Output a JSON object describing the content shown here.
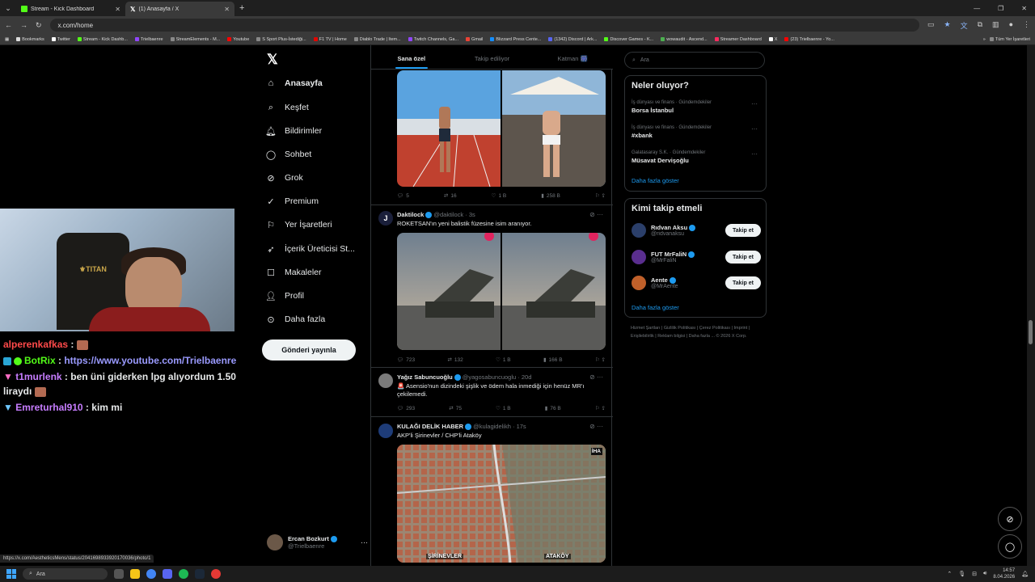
{
  "browser": {
    "tabs": [
      {
        "title": "Stream - Kick Dashboard",
        "icon": "kick-icon"
      },
      {
        "title": "(1) Anasayfa / X",
        "icon": "x-icon"
      }
    ],
    "url": "x.com/home",
    "bookmarks": [
      "Bookmarks",
      "Twitter",
      "Stream - Kick Dashb...",
      "Trielbaenre",
      "StreamElements - M...",
      "Youtube",
      "S Sport Plus-İstediği...",
      "F1 TV | Home",
      "Diablo Trade | Item...",
      "Twitch Channels, Ga...",
      "Gmail",
      "Blizzard Press Cente...",
      "(1342) Discord | Ark...",
      "Discover Games - K...",
      "wowaudit - Ascend...",
      "Streamer Dashboard",
      "X",
      "(23) Trielbaenre - Yo..."
    ],
    "bookmarks_right": "Tüm Yer İşaretleri",
    "status_url": "https://x.com/AestheticsMens/status/2041698933920170036/photo/1"
  },
  "chat": [
    {
      "user": "alperenkafkas",
      "sep": " : ",
      "msg": "",
      "color": "#ff4a4a",
      "emote": true
    },
    {
      "user": "BotRix",
      "sep": " : ",
      "msg": "https://www.youtube.com/Trielbaenre",
      "color": "#53fc18",
      "msg_color": "#9a9aff",
      "emote": false
    },
    {
      "user": "t1murlenk",
      "sep": " : ",
      "msg": "ben üni giderken lpg alıyordum 1.50 liraydı",
      "color": "#c77dff",
      "emote": true
    },
    {
      "user": "Emreturhal910",
      "sep": " : ",
      "msg": "kim mi",
      "color": "#c77dff",
      "emote": false
    }
  ],
  "nav": {
    "items": [
      {
        "label": "Anasayfa",
        "icon": "home-icon"
      },
      {
        "label": "Keşfet",
        "icon": "search-icon"
      },
      {
        "label": "Bildirimler",
        "icon": "bell-icon"
      },
      {
        "label": "Sohbet",
        "icon": "chat-icon"
      },
      {
        "label": "Grok",
        "icon": "grok-icon"
      },
      {
        "label": "Premium",
        "icon": "premium-icon"
      },
      {
        "label": "Yer İşaretleri",
        "icon": "bookmark-icon"
      },
      {
        "label": "İçerik Üreticisi St...",
        "icon": "rocket-icon"
      },
      {
        "label": "Makaleler",
        "icon": "articles-icon"
      },
      {
        "label": "Profil",
        "icon": "profile-icon"
      },
      {
        "label": "Daha fazla",
        "icon": "more-icon"
      }
    ],
    "post_button": "Gönderi yayınla",
    "account": {
      "name": "Ercan Bozkurt",
      "handle": "@Trielbaenre"
    }
  },
  "feed": {
    "tabs": [
      "Sana özel",
      "Takip ediliyor",
      "Katman 🎆"
    ],
    "tweets": [
      {
        "actions": [
          "5",
          "16",
          "1 B",
          "258 B"
        ]
      },
      {
        "name": "Daktilock",
        "handle": "@daktilock",
        "time": "3s",
        "text": "ROKETSAN'ın yeni balistik füzesine isim aranıyor.",
        "actions": [
          "723",
          "132",
          "1 B",
          "166 B"
        ]
      },
      {
        "name": "Yağız Sabuncuoğlu",
        "handle": "@yagosabuncuoglu",
        "time": "20d",
        "text": "🚨 Asensio'nun dizindeki şişlik ve ödem hala inmediği için henüz MR'ı çekilemedi.",
        "actions": [
          "293",
          "75",
          "1 B",
          "76 B"
        ]
      },
      {
        "name": "KULAĞI DELİK HABER",
        "handle": "@kulagidelikh",
        "time": "17s",
        "text": "AKP'li Şirinevler / CHP'li Ataköy",
        "labels": [
          "ŞİRİNEVLER",
          "ATAKÖY"
        ],
        "badge": "İHA"
      }
    ]
  },
  "search": {
    "placeholder": "Ara"
  },
  "trends": {
    "title": "Neler oluyor?",
    "items": [
      {
        "cat": "İş dünyası ve finans · Gündemdekiler",
        "topic": "Borsa İstanbul"
      },
      {
        "cat": "İş dünyası ve finans · Gündemdekiler",
        "topic": "#xbank"
      },
      {
        "cat": "Galatasaray S.K. · Gündemdekiler",
        "topic": "Müsavat Dervişoğlu"
      }
    ],
    "more": "Daha fazla göster"
  },
  "who_to_follow": {
    "title": "Kimi takip etmeli",
    "items": [
      {
        "name": "Rıdvan Aksu",
        "handle": "@ridvanaksu",
        "btn": "Takip et"
      },
      {
        "name": "FUT MrFaliN",
        "handle": "@MrFaliN",
        "btn": "Takip et"
      },
      {
        "name": "Aente",
        "handle": "@MrAente",
        "btn": "Takip et"
      }
    ],
    "more": "Daha fazla göster"
  },
  "footer": "Hizmet Şartları | Gizlilik Politikası | Çerez Politikası | Imprint | Erişilebilirlik | Reklam bilgisi | Daha fazla ... © 2026 X Corp.",
  "taskbar": {
    "search": "Ara",
    "time": "14:57",
    "date": "8.04.2026"
  },
  "colors": {
    "accent": "#1d9bf0",
    "bg": "#000000",
    "border": "#2f3336"
  }
}
